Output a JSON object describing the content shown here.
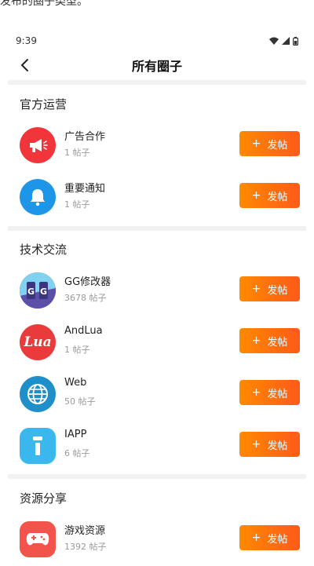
{
  "top_caption": "发布的圈子类型。",
  "status_bar": {
    "time": "9:39"
  },
  "nav": {
    "title": "所有圈子"
  },
  "post_button_label": "发帖",
  "colors": {
    "accent_start": "#ff8a00",
    "accent_end": "#ff5a1a"
  },
  "sections": [
    {
      "title": "官方运营",
      "items": [
        {
          "name": "广告合作",
          "count": "1 帖子",
          "icon": "megaphone-icon",
          "icon_color": "#f2343b"
        },
        {
          "name": "重要通知",
          "count": "1 帖子",
          "icon": "bell-icon",
          "icon_color": "#1e96e8"
        }
      ]
    },
    {
      "title": "技术交流",
      "items": [
        {
          "name": "GG修改器",
          "count": "3678 帖子",
          "icon": "gg-logo-icon",
          "icon_color": "#6b5fb5"
        },
        {
          "name": "AndLua",
          "count": "1 帖子",
          "icon": "lua-logo-icon",
          "icon_color": "#e93b3b",
          "logo_text": "Lua"
        },
        {
          "name": "Web",
          "count": "50 帖子",
          "icon": "globe-icon",
          "icon_color": "#1e8fc8"
        },
        {
          "name": "IAPP",
          "count": "6 帖子",
          "icon": "info-i-icon",
          "icon_color": "#3ab8ee"
        }
      ]
    },
    {
      "title": "资源分享",
      "items": [
        {
          "name": "游戏资源",
          "count": "1392 帖子",
          "icon": "gamepad-icon",
          "icon_color": "#f2534b"
        }
      ]
    }
  ]
}
